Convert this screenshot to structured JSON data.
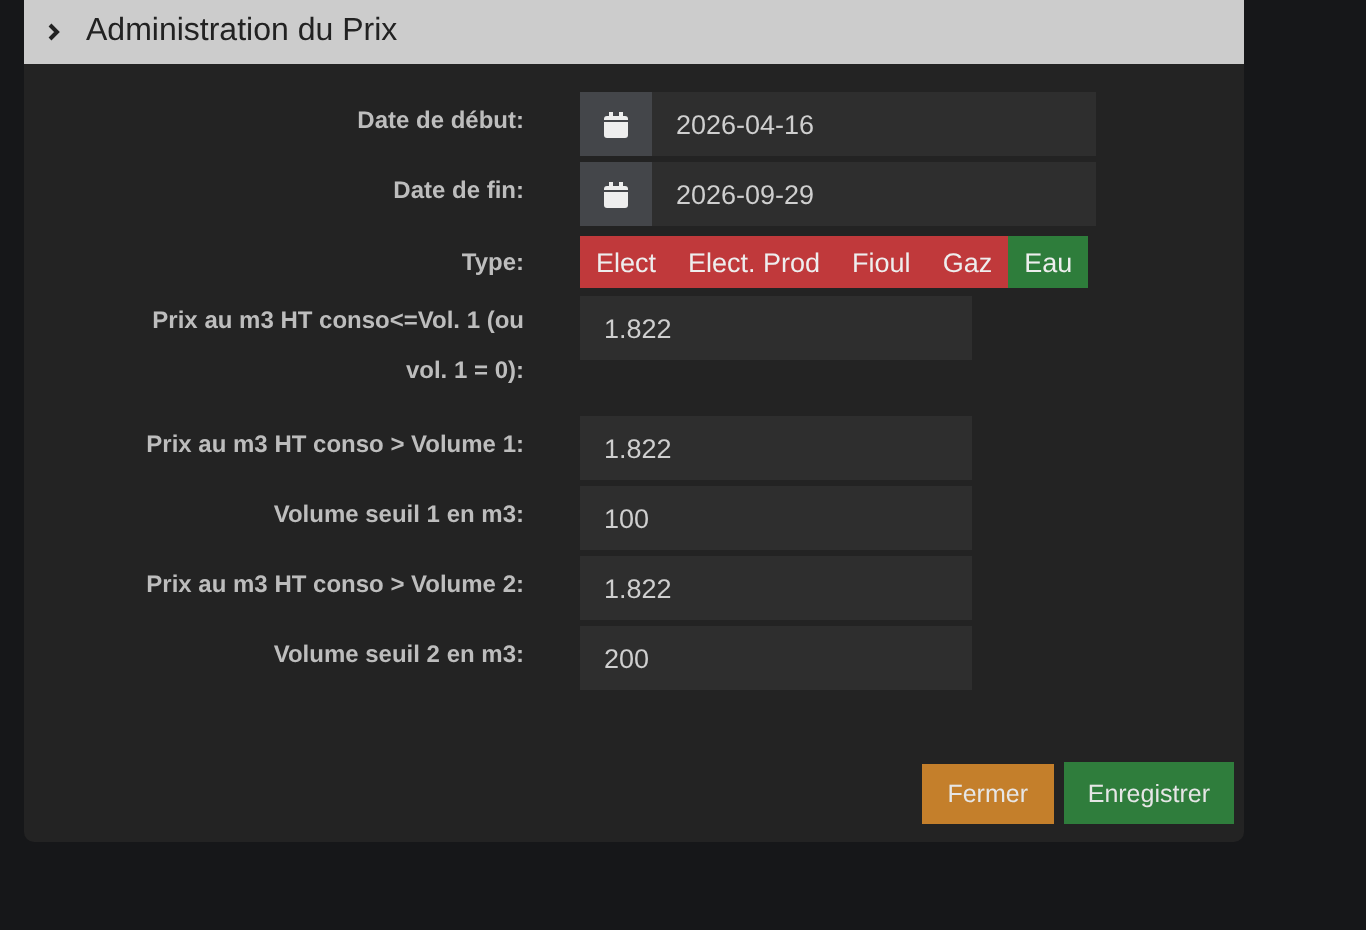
{
  "panel": {
    "title": "Administration du Prix"
  },
  "fields": [
    {
      "kind": "date",
      "label": "Date de début:",
      "value": "2026-04-16"
    },
    {
      "kind": "date",
      "label": "Date de fin:",
      "value": "2026-09-29"
    },
    {
      "kind": "type",
      "label": "Type:",
      "options": [
        {
          "label": "Elect",
          "selected": false
        },
        {
          "label": "Elect. Prod",
          "selected": false
        },
        {
          "label": "Fioul",
          "selected": false
        },
        {
          "label": "Gaz",
          "selected": false
        },
        {
          "label": "Eau",
          "selected": true
        }
      ]
    },
    {
      "kind": "number",
      "label": "Prix au m3 HT conso<=Vol. 1 (ou vol. 1 = 0):",
      "value": "1.822"
    },
    {
      "kind": "number",
      "label": "Prix au m3 HT conso > Volume 1:",
      "value": "1.822"
    },
    {
      "kind": "number",
      "label": "Volume seuil 1 en m3:",
      "value": "100"
    },
    {
      "kind": "number",
      "label": "Prix au m3 HT conso > Volume 2:",
      "value": "1.822"
    },
    {
      "kind": "number",
      "label": "Volume seuil 2 en m3:",
      "value": "200"
    }
  ],
  "buttons": [
    {
      "kind": "close",
      "label": "Fermer"
    },
    {
      "kind": "save",
      "label": "Enregistrer"
    }
  ]
}
